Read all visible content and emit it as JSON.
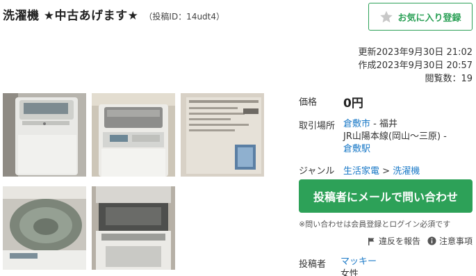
{
  "header": {
    "title": "洗濯機 ★中古あげます★",
    "post_id": "（投稿ID：14udt4）",
    "favorite_label": "お気に入り登録"
  },
  "meta": {
    "updated": "更新2023年9月30日 21:02",
    "created": "作成2023年9月30日 20:57",
    "views": "閲覧数：19"
  },
  "photos": [
    {
      "icon": "washing-machine-front-photo"
    },
    {
      "icon": "washing-machine-top-photo"
    },
    {
      "icon": "spec-label-photo"
    },
    {
      "icon": "drum-interior-photo"
    },
    {
      "icon": "lid-open-photo"
    }
  ],
  "details": {
    "price_label": "価格",
    "price_value": "0円",
    "location_label": "取引場所",
    "location_city": "倉敷市",
    "location_sep": " - 福井",
    "location_line": "JR山陽本線(岡山〜三原) -",
    "location_station": "倉敷駅",
    "genre_label": "ジャンル",
    "genre_parent": "生活家電",
    "genre_sep": " > ",
    "genre_child": "洗濯機",
    "poster_label": "投稿者",
    "poster_name": "マッキー",
    "poster_gender": "女性"
  },
  "actions": {
    "contact_label": "投稿者にメールで問い合わせ",
    "note": "※問い合わせは会員登録とログイン必須です",
    "report_label": "違反を報告",
    "caution_label": "注意事項"
  },
  "colors": {
    "accent": "#2da158",
    "link": "#1a79c7"
  }
}
